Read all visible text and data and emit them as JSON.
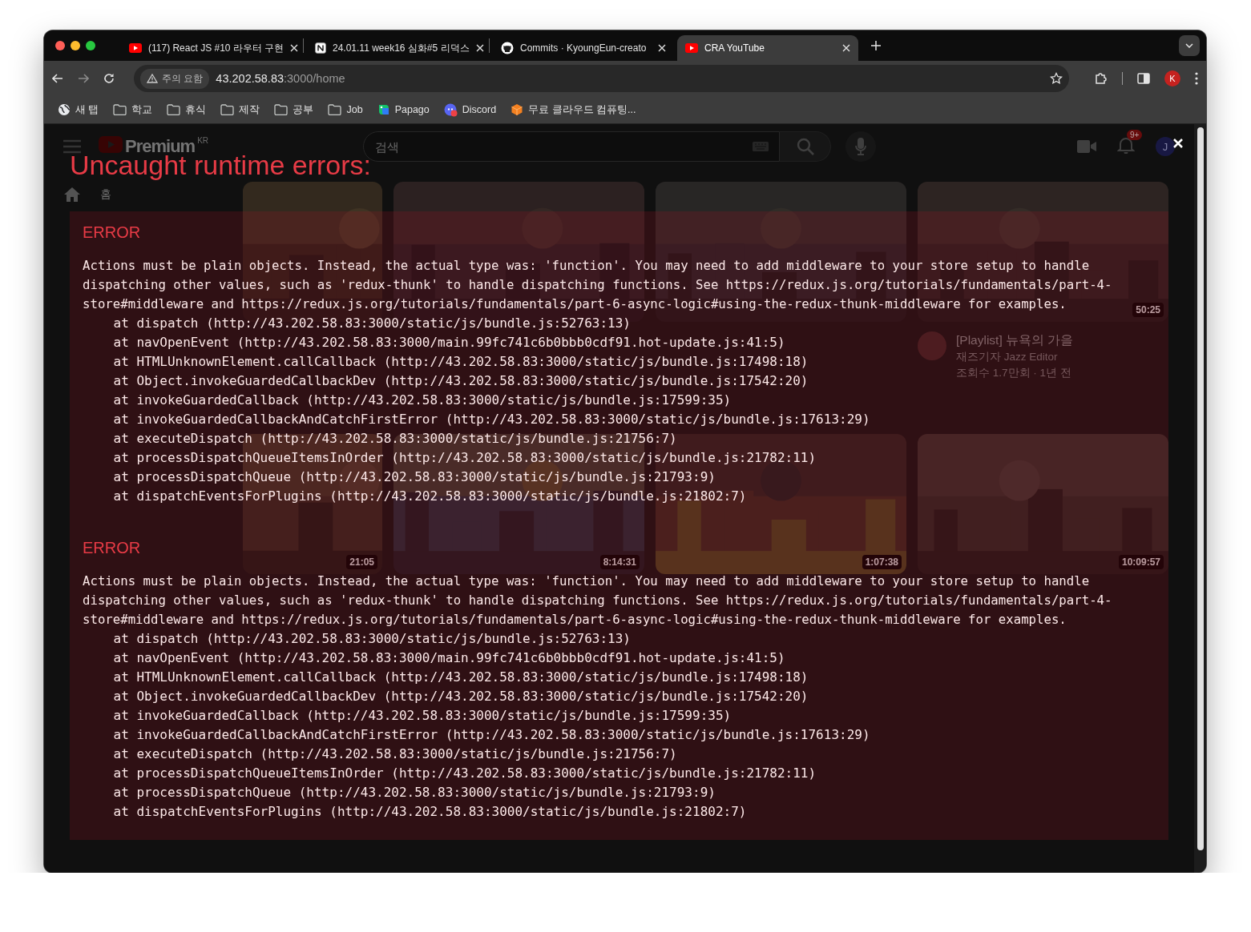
{
  "browser": {
    "tabs": [
      {
        "title": "(117) React JS #10 라우터 구현",
        "kind": "youtube",
        "selected": false
      },
      {
        "title": "24.01.11 week16 심화#5 리덕스",
        "kind": "notebook",
        "selected": false
      },
      {
        "title": "Commits · KyoungEun-creato",
        "kind": "cat",
        "selected": false
      },
      {
        "title": "CRA YouTube",
        "kind": "youtube",
        "selected": true
      }
    ],
    "address": {
      "security": "주의 요함",
      "host": "43.202.58.83",
      "path": ":3000/home"
    },
    "profile": "K",
    "bookmarks": [
      {
        "label": "새 탭",
        "kind": "globe"
      },
      {
        "label": "학교",
        "kind": "folder"
      },
      {
        "label": "휴식",
        "kind": "folder"
      },
      {
        "label": "제작",
        "kind": "folder"
      },
      {
        "label": "공부",
        "kind": "folder"
      },
      {
        "label": "Job",
        "kind": "folder"
      },
      {
        "label": "Papago",
        "kind": "papago"
      },
      {
        "label": "Discord",
        "kind": "discord"
      },
      {
        "label": "무료 클라우드 컴퓨팅...",
        "kind": "cube"
      }
    ]
  },
  "page": {
    "header": {
      "logo": "Premium",
      "region": "KR",
      "search": {
        "placeholder": "검색"
      },
      "notifications": "9+",
      "avatar": "J"
    },
    "sidebar": [
      {
        "label": "홈",
        "kind": "home"
      }
    ],
    "videos": [
      {
        "kind": "picture"
      },
      {
        "kind": "picture"
      },
      {
        "kind": "picture"
      },
      {
        "kind": "picture",
        "duration": "50:25",
        "title": "[Playlist] 뉴욕의 가을",
        "channel": "재즈기자 Jazz Editor",
        "meta": "조회수 1.7만회 · 1년 전"
      },
      {
        "kind": "picture",
        "duration": "21:05"
      },
      {
        "kind": "picture",
        "duration": "8:14:31"
      },
      {
        "kind": "picture",
        "duration": "1:07:38"
      },
      {
        "kind": "picture",
        "duration": "10:09:57"
      }
    ]
  },
  "overlay": {
    "title": "Uncaught runtime errors:",
    "errors": [
      {
        "label": "ERROR",
        "message": "Actions must be plain objects. Instead, the actual type was: 'function'. You may need to add middleware to your store setup to handle dispatching other values, such as 'redux-thunk' to handle dispatching functions. See https://redux.js.org/tutorials/fundamentals/part-4-store#middleware and https://redux.js.org/tutorials/fundamentals/part-6-async-logic#using-the-redux-thunk-middleware for examples.",
        "stack": [
          "at dispatch (http://43.202.58.83:3000/static/js/bundle.js:52763:13)",
          "at navOpenEvent (http://43.202.58.83:3000/main.99fc741c6b0bbb0cdf91.hot-update.js:41:5)",
          "at HTMLUnknownElement.callCallback (http://43.202.58.83:3000/static/js/bundle.js:17498:18)",
          "at Object.invokeGuardedCallbackDev (http://43.202.58.83:3000/static/js/bundle.js:17542:20)",
          "at invokeGuardedCallback (http://43.202.58.83:3000/static/js/bundle.js:17599:35)",
          "at invokeGuardedCallbackAndCatchFirstError (http://43.202.58.83:3000/static/js/bundle.js:17613:29)",
          "at executeDispatch (http://43.202.58.83:3000/static/js/bundle.js:21756:7)",
          "at processDispatchQueueItemsInOrder (http://43.202.58.83:3000/static/js/bundle.js:21782:11)",
          "at processDispatchQueue (http://43.202.58.83:3000/static/js/bundle.js:21793:9)",
          "at dispatchEventsForPlugins (http://43.202.58.83:3000/static/js/bundle.js:21802:7)"
        ]
      },
      {
        "label": "ERROR",
        "message": "Actions must be plain objects. Instead, the actual type was: 'function'. You may need to add middleware to your store setup to handle dispatching other values, such as 'redux-thunk' to handle dispatching functions. See https://redux.js.org/tutorials/fundamentals/part-4-store#middleware and https://redux.js.org/tutorials/fundamentals/part-6-async-logic#using-the-redux-thunk-middleware for examples.",
        "stack": [
          "at dispatch (http://43.202.58.83:3000/static/js/bundle.js:52763:13)",
          "at navOpenEvent (http://43.202.58.83:3000/main.99fc741c6b0bbb0cdf91.hot-update.js:41:5)",
          "at HTMLUnknownElement.callCallback (http://43.202.58.83:3000/static/js/bundle.js:17498:18)",
          "at Object.invokeGuardedCallbackDev (http://43.202.58.83:3000/static/js/bundle.js:17542:20)",
          "at invokeGuardedCallback (http://43.202.58.83:3000/static/js/bundle.js:17599:35)",
          "at invokeGuardedCallbackAndCatchFirstError (http://43.202.58.83:3000/static/js/bundle.js:17613:29)",
          "at executeDispatch (http://43.202.58.83:3000/static/js/bundle.js:21756:7)",
          "at processDispatchQueueItemsInOrder (http://43.202.58.83:3000/static/js/bundle.js:21782:11)",
          "at processDispatchQueue (http://43.202.58.83:3000/static/js/bundle.js:21793:9)",
          "at dispatchEventsForPlugins (http://43.202.58.83:3000/static/js/bundle.js:21802:7)"
        ]
      }
    ]
  }
}
